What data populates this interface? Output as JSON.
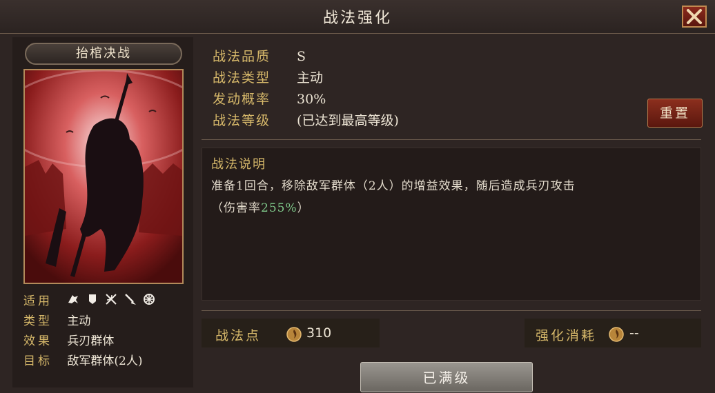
{
  "header": {
    "title": "战法强化"
  },
  "skill": {
    "name": "抬棺决战",
    "attributes": [
      {
        "label": "适用",
        "value": "",
        "icons": [
          "cavalry-icon",
          "shield-icon",
          "bow-icon",
          "spear-icon",
          "wheel-icon"
        ]
      },
      {
        "label": "类型",
        "value": "主动"
      },
      {
        "label": "效果",
        "value": "兵刃群体"
      },
      {
        "label": "目标",
        "value": "敌军群体(2人)"
      }
    ]
  },
  "info": {
    "quality_label": "战法品质",
    "quality_value": "S",
    "type_label": "战法类型",
    "type_value": "主动",
    "rate_label": "发动概率",
    "rate_value": "30%",
    "level_label": "战法等级",
    "level_value": "(已达到最高等级)",
    "reset_label": "重置"
  },
  "description": {
    "title": "战法说明",
    "line1": "准备1回合，移除敌军群体（2人）的增益效果，随后造成兵刃攻击",
    "line2_prefix": "（伤害率",
    "line2_highlight": "255%",
    "line2_suffix": "）"
  },
  "footer": {
    "points_label": "战法点",
    "points_value": "310",
    "cost_label": "强化消耗",
    "cost_value": "--",
    "max_button": "已满级"
  },
  "colors": {
    "gold": "#d6b86a",
    "highlight": "#7fc88a",
    "red_button": "#8c2f1e"
  }
}
